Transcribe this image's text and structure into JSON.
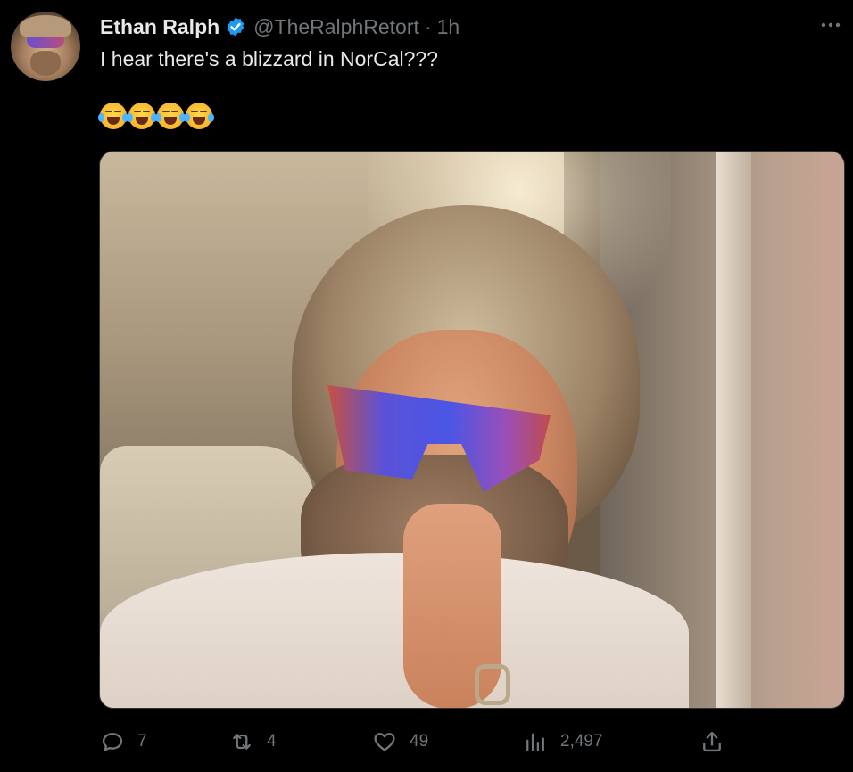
{
  "author": {
    "display_name": "Ethan Ralph",
    "handle": "@TheRalphRetort",
    "separator": "·",
    "time": "1h",
    "verified_color": "#1d9bf0"
  },
  "tweet": {
    "text": "I hear there's a blizzard in NorCal???",
    "emojis": [
      "face-with-tears-of-joy",
      "face-with-tears-of-joy",
      "face-with-tears-of-joy",
      "face-with-tears-of-joy"
    ]
  },
  "actions": {
    "replies": "7",
    "retweets": "4",
    "likes": "49",
    "views": "2,497"
  },
  "colors": {
    "background": "#000000",
    "text": "#e7e9ea",
    "muted": "#71767b"
  }
}
